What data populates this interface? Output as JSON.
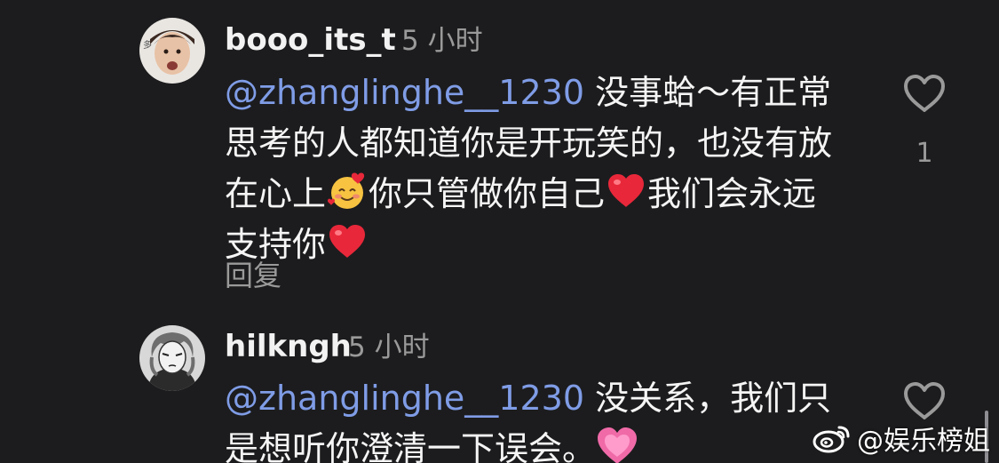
{
  "comments": [
    {
      "username": "booo_its_t",
      "time": "5 小时",
      "mention": "@zhanglinghe__1230",
      "text_segments": [
        "没事蛤～有正常思考的人都知道你是开玩笑的，也没有放在心上",
        "你只管做你自己",
        "我们会永远支持你"
      ],
      "like_count": "1",
      "reply_label": "回复"
    },
    {
      "username": "hilkngh",
      "time": "5 小时",
      "mention": "@zhanglinghe__1230",
      "text_segments": [
        "没关系，我们只是想听你澄清一下误会。"
      ]
    }
  ],
  "watermark": "@娱乐榜姐",
  "icons": {
    "like": "heart-outline-icon",
    "emoji_smile": "smiling-face-with-hearts-emoji",
    "emoji_heart": "red-heart-emoji",
    "emoji_pink_heart": "growing-pink-heart-emoji",
    "weibo": "weibo-logo-icon"
  },
  "colors": {
    "background": "#1c1c1e",
    "mention": "#7f9ce6",
    "text": "#f5f5f5",
    "muted": "#9a9a9a"
  }
}
